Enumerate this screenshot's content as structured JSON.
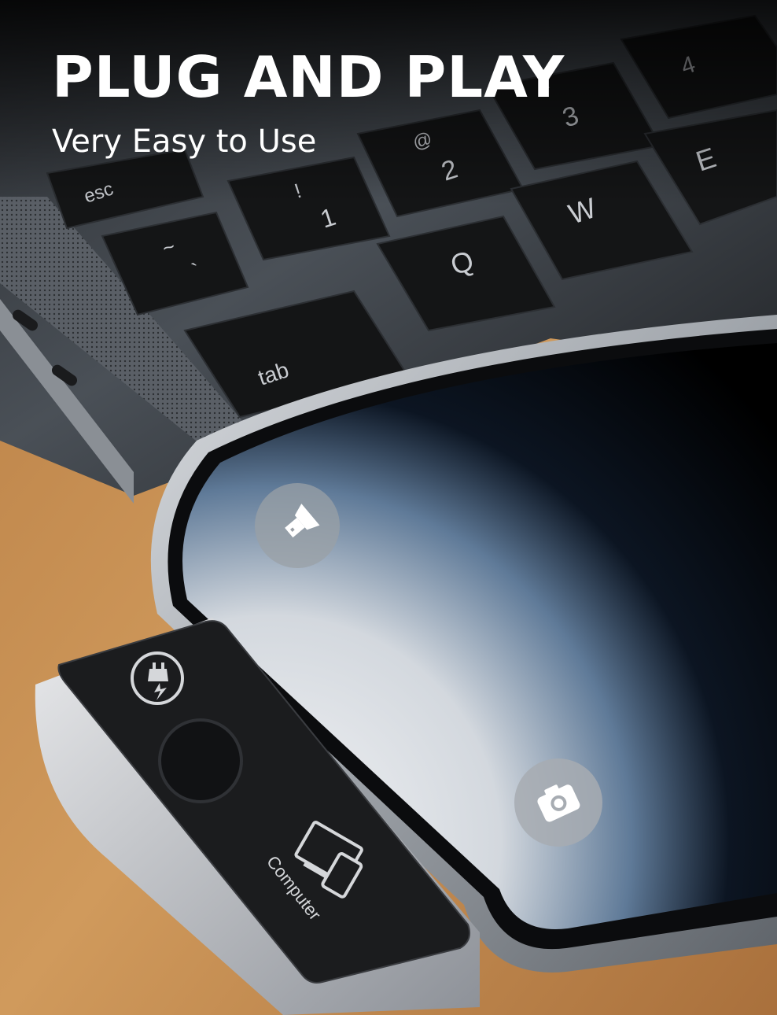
{
  "headline": "PLUG AND PLAY",
  "subheadline": "Very Easy to Use",
  "keyboard": {
    "keys": {
      "esc": "esc",
      "tilde": "~",
      "backtick": "`",
      "exclaim": "!",
      "one": "1",
      "at": "@",
      "two": "2",
      "hash": "#",
      "three": "3",
      "four": "4",
      "q": "Q",
      "w": "W",
      "e": "E",
      "tab": "tab"
    }
  },
  "adapter": {
    "mode_label": "Computer"
  },
  "icons": {
    "flashlight": "flashlight-icon",
    "camera": "camera-icon",
    "charging": "charging-plug-icon",
    "computer": "computer-phone-icon"
  },
  "colors": {
    "wood": "#c48a4f",
    "laptop_body": "#6f757d",
    "keys": "#141516",
    "phone_frame": "#b8bcc2",
    "adapter_face": "#1b1c1e"
  }
}
